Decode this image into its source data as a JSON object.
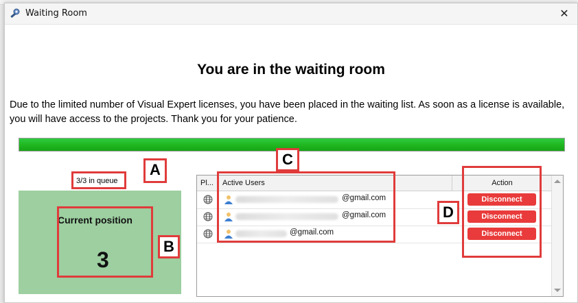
{
  "window": {
    "title": "Waiting Room",
    "close_glyph": "✕"
  },
  "main": {
    "heading": "You are in the waiting room",
    "message": "Due to the limited number of Visual Expert licenses, you have been placed in the waiting list. As soon as a license is available, you will have access to the projects. Thank you for your patience.",
    "progress": 1.0
  },
  "queue": {
    "label": "3/3 in queue",
    "position_caption": "Current position",
    "position_value": "3",
    "panel_color": "#9dcfa0"
  },
  "grid": {
    "columns": [
      {
        "label": "Pl..."
      },
      {
        "label": "Active Users"
      },
      {
        "label": ""
      },
      {
        "label": "Action"
      }
    ],
    "rows": [
      {
        "email": "@gmail.com",
        "action": "Disconnect",
        "icon": "globe-icon"
      },
      {
        "email": "@gmail.com",
        "action": "Disconnect",
        "icon": "globe-icon"
      },
      {
        "email": "@gmail.com",
        "action": "Disconnect",
        "icon": "globe-icon"
      }
    ]
  },
  "annotations": {
    "a": "A",
    "b": "B",
    "c": "C",
    "d": "D",
    "color": "#e03b3b"
  },
  "colors": {
    "accent": "#e93b3b",
    "progress": "#1fb61f"
  }
}
